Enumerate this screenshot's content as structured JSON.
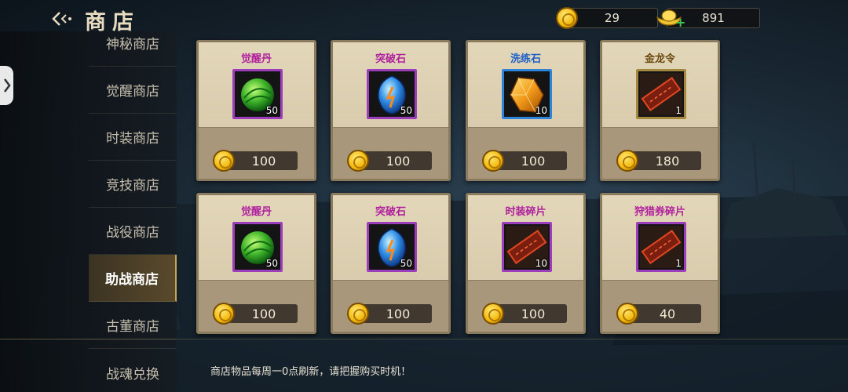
{
  "header": {
    "title": "商店"
  },
  "sidebar": {
    "items": [
      {
        "label": "神秘商店",
        "active": false
      },
      {
        "label": "觉醒商店",
        "active": false
      },
      {
        "label": "时装商店",
        "active": false
      },
      {
        "label": "竞技商店",
        "active": false
      },
      {
        "label": "战役商店",
        "active": false
      },
      {
        "label": "助战商店",
        "active": true
      },
      {
        "label": "古董商店",
        "active": false
      },
      {
        "label": "战魂兑换",
        "active": false
      }
    ]
  },
  "currency": {
    "gold": "29",
    "ingot": "891"
  },
  "items": [
    {
      "name": "觉醒丹",
      "name_color": "#b0209e",
      "icon": "green-orb-icon",
      "count": "50",
      "price": "100",
      "frame": "purple"
    },
    {
      "name": "突破石",
      "name_color": "#b0209e",
      "icon": "blue-crystal-icon",
      "count": "50",
      "price": "100",
      "frame": "purple"
    },
    {
      "name": "洗练石",
      "name_color": "#1d5fc7",
      "icon": "amber-stone-icon",
      "count": "10",
      "price": "100",
      "frame": "blue"
    },
    {
      "name": "金龙令",
      "name_color": "#6a4a12",
      "icon": "red-token-icon",
      "count": "1",
      "price": "180",
      "frame": "gold"
    },
    {
      "name": "觉醒丹",
      "name_color": "#b0209e",
      "icon": "green-orb-icon",
      "count": "50",
      "price": "100",
      "frame": "purple"
    },
    {
      "name": "突破石",
      "name_color": "#b0209e",
      "icon": "blue-crystal-icon",
      "count": "50",
      "price": "100",
      "frame": "purple"
    },
    {
      "name": "时装碎片",
      "name_color": "#b0209e",
      "icon": "red-token-icon",
      "count": "10",
      "price": "100",
      "frame": "red"
    },
    {
      "name": "狩猎券碎片",
      "name_color": "#b0209e",
      "icon": "red-token-icon",
      "count": "1",
      "price": "40",
      "frame": "red"
    }
  ],
  "notice": "商店物品每周一0点刷新，请把握购买时机！"
}
